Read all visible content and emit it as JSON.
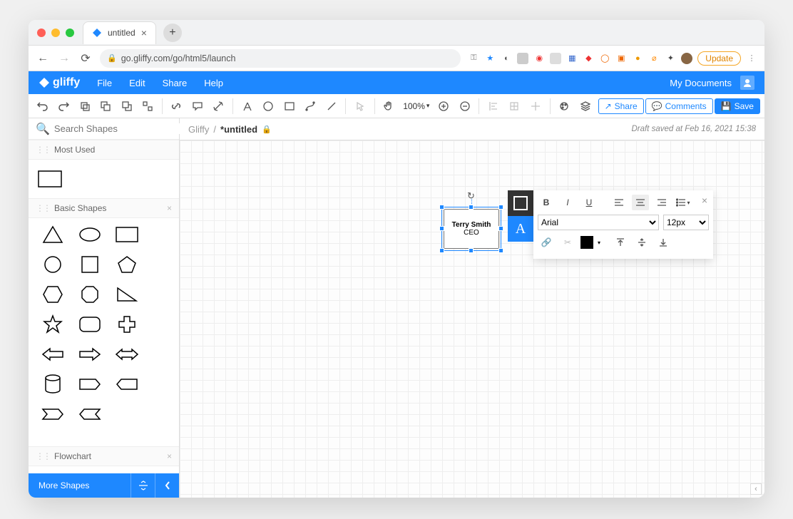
{
  "browser": {
    "tab_title": "untitled",
    "url": "go.gliffy.com/go/html5/launch",
    "update_label": "Update"
  },
  "menu": {
    "logo": "gliffy",
    "items": [
      "File",
      "Edit",
      "Share",
      "Help"
    ],
    "mydocs": "My Documents"
  },
  "toolbar": {
    "zoom": "100%",
    "share": "Share",
    "comments": "Comments",
    "save": "Save"
  },
  "breadcrumb": {
    "root": "Gliffy",
    "sep": " / ",
    "doc": "*untitled",
    "status": "Draft saved at Feb 16, 2021 15:38"
  },
  "sidepanel": {
    "search_placeholder": "Search Shapes",
    "cat_mostused": "Most Used",
    "cat_basic": "Basic Shapes",
    "cat_flowchart": "Flowchart",
    "moreshapes": "More Shapes"
  },
  "shape": {
    "name": "Terry Smith",
    "role": "CEO"
  },
  "fmt": {
    "font": "Arial",
    "size": "12px"
  }
}
